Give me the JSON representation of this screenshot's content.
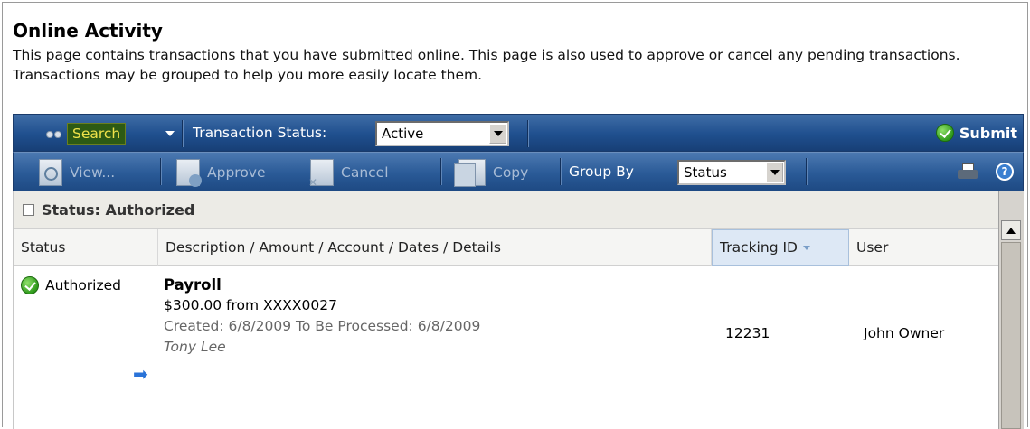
{
  "page": {
    "title": "Online Activity",
    "description": "This page contains transactions that you have submitted online. This page is also used to approve or cancel any pending transactions. Transactions may be grouped to help you more easily locate them."
  },
  "toolbar_top": {
    "search_label": "Search",
    "status_label": "Transaction Status:",
    "status_value": "Active",
    "submit_label": "Submit"
  },
  "toolbar_actions": {
    "view_label": "View...",
    "approve_label": "Approve",
    "cancel_label": "Cancel",
    "copy_label": "Copy",
    "group_by_label": "Group By",
    "group_by_value": "Status",
    "help_glyph": "?"
  },
  "grid": {
    "group_label": "Status: Authorized",
    "columns": [
      "Status",
      "Description / Amount / Account / Dates / Details",
      "Tracking ID",
      "User"
    ],
    "rows": [
      {
        "status": "Authorized",
        "title": "Payroll",
        "amount_line": "$300.00 from XXXX0027",
        "dates_line": "Created: 6/8/2009 To Be Processed: 6/8/2009",
        "details": "Tony Lee",
        "tracking_id": "12231",
        "user": "John Owner"
      }
    ]
  },
  "icons": [
    "binoculars-icon",
    "check-icon",
    "view-icon",
    "approve-icon",
    "cancel-icon",
    "copy-icon",
    "printer-icon",
    "help-icon",
    "arrow-right-icon"
  ],
  "colors": {
    "toolbar": "#1f4f8e",
    "search_highlight": "#2d5a14",
    "search_text": "#f0e24a",
    "grid_header": "#f5f5f3"
  }
}
